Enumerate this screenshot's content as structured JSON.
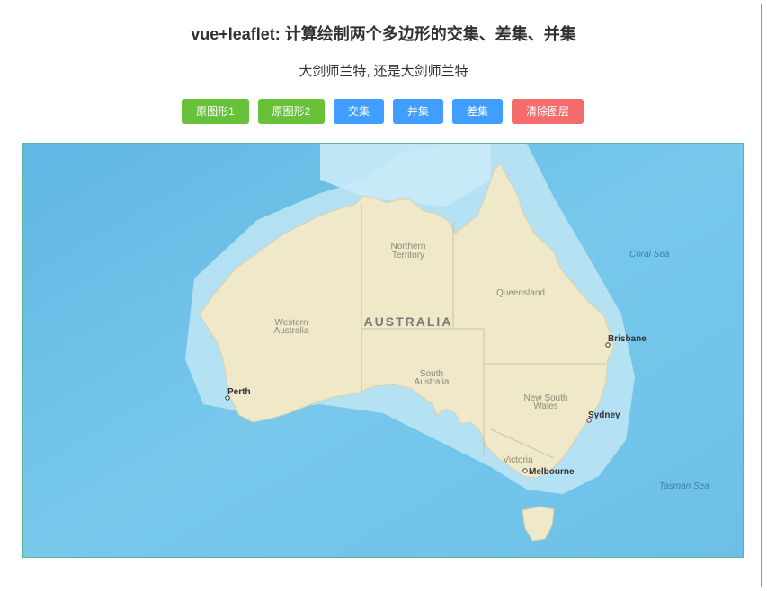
{
  "header": {
    "title": "vue+leaflet: 计算绘制两个多边形的交集、差集、并集",
    "subtitle": "大剑师兰特, 还是大剑师兰特"
  },
  "toolbar": {
    "buttons": [
      {
        "label": "原图形1",
        "color": "#67c23a"
      },
      {
        "label": "原图形2",
        "color": "#67c23a"
      },
      {
        "label": "交集",
        "color": "#409eff"
      },
      {
        "label": "并集",
        "color": "#409eff"
      },
      {
        "label": "差集",
        "color": "#409eff"
      },
      {
        "label": "清除图层",
        "color": "#f56c6c"
      }
    ]
  },
  "map": {
    "country_label": "AUSTRALIA",
    "regions": {
      "northern_territory": [
        "Northern",
        "Territory"
      ],
      "western_australia": [
        "Western",
        "Australia"
      ],
      "queensland": "Queensland",
      "south_australia": [
        "South",
        "Australia"
      ],
      "new_south_wales": [
        "New South",
        "Wales"
      ],
      "victoria": "Victoria"
    },
    "cities": {
      "perth": "Perth",
      "brisbane": "Brisbane",
      "sydney": "Sydney",
      "melbourne": "Melbourne"
    },
    "seas": {
      "coral_sea": "Coral Sea",
      "tasman_sea": "Tasman Sea"
    },
    "colors": {
      "ocean_deep": "#6fc1e8",
      "ocean_shallow": "#bfe6f5",
      "land": "#efe9c9",
      "border": "#c9c2a6"
    }
  }
}
